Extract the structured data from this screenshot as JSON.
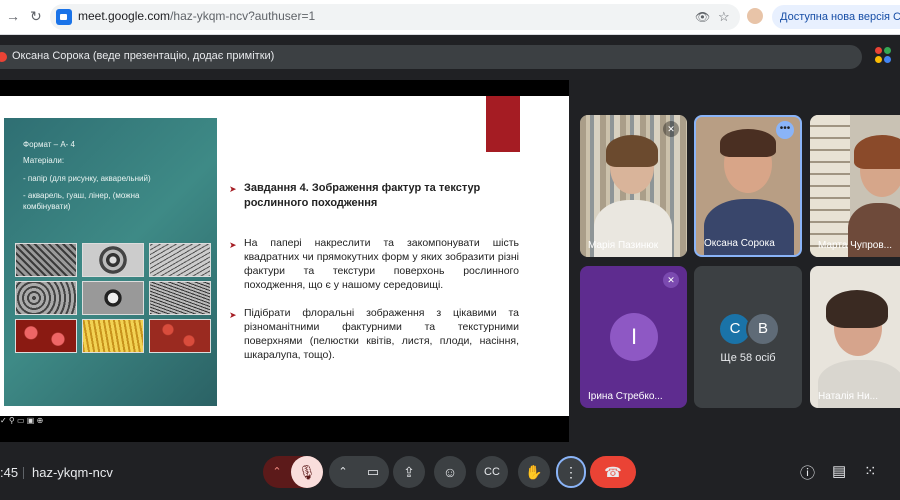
{
  "browser": {
    "url_host": "meet.google.com",
    "url_path": "/haz-ykqm-ncv?authuser=1",
    "update_label": "Доступна нова версія Chrome"
  },
  "presenter_banner": {
    "text": "Оксана Сорока (веде презентацію, додає примітки)"
  },
  "slide": {
    "panel_lines": [
      "Формат – А- 4",
      "Матеріали:",
      "- папір (для рисунку, акварельний)",
      "- акварель, гуаш, лінер, (можна",
      "комбінувати)"
    ],
    "task_title": "Завдання 4. Зображення фактур та текстур рослинного походження",
    "paragraph1": "На папері накреслити та закомпонувати шість квадратних чи прямокутних форм у яких зобразити різні фактури та текстури поверхонь рослинного походження, що є у нашому середовищі.",
    "paragraph2": "Підібрати флоральні зображення з цікавими та різноманітними фактурними та текстурними поверхнями (пелюстки квітів, листя, плоди, насіння, шкаралупа, тощо).",
    "accent_color": "#a51c23"
  },
  "participants": [
    {
      "name": "Марія Пазинюк",
      "muted": true
    },
    {
      "name": "Оксана Сорока",
      "muted": false,
      "active_speaker": true
    },
    {
      "name": "Марта Чупров..."
    },
    {
      "name": "Ірина Стребко...",
      "initial": "І",
      "muted": true
    },
    {
      "name": "Ще 58 осіб",
      "initials": [
        "С",
        "В"
      ]
    },
    {
      "name": "Наталія Ни..."
    }
  ],
  "bottom_bar": {
    "time": ":45",
    "meeting_code": "haz-ykqm-ncv"
  }
}
